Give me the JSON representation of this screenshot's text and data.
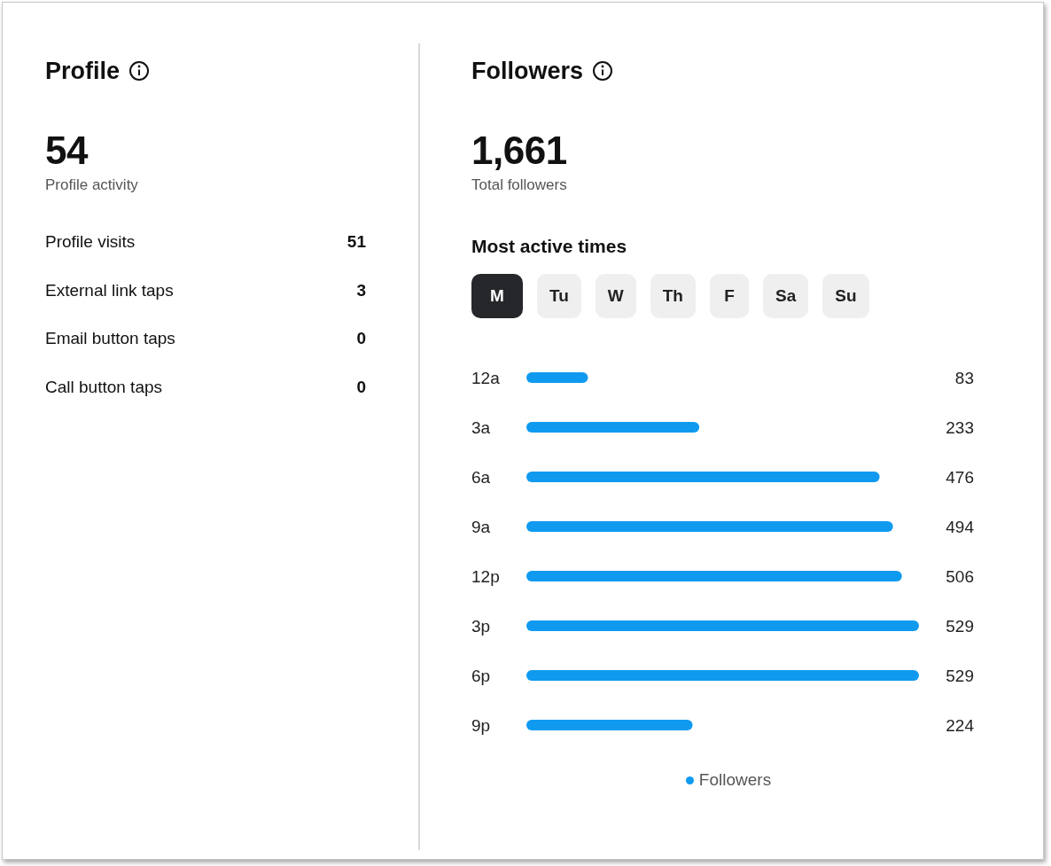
{
  "profile": {
    "title": "Profile",
    "total": "54",
    "total_label": "Profile activity",
    "metrics": [
      {
        "label": "Profile visits",
        "value": "51"
      },
      {
        "label": "External link taps",
        "value": "3"
      },
      {
        "label": "Email button taps",
        "value": "0"
      },
      {
        "label": "Call button taps",
        "value": "0"
      }
    ]
  },
  "followers": {
    "title": "Followers",
    "total": "1,661",
    "total_label": "Total followers",
    "section_title": "Most active times",
    "days": [
      {
        "label": "M",
        "selected": true
      },
      {
        "label": "Tu",
        "selected": false
      },
      {
        "label": "W",
        "selected": false
      },
      {
        "label": "Th",
        "selected": false
      },
      {
        "label": "F",
        "selected": false
      },
      {
        "label": "Sa",
        "selected": false
      },
      {
        "label": "Su",
        "selected": false
      }
    ],
    "chart_data": {
      "type": "bar",
      "orientation": "horizontal",
      "categories": [
        "12a",
        "3a",
        "6a",
        "9a",
        "12p",
        "3p",
        "6p",
        "9p"
      ],
      "series": [
        {
          "name": "Followers",
          "color": "#0f9af0",
          "values": [
            83,
            233,
            476,
            494,
            506,
            529,
            529,
            224
          ]
        }
      ],
      "data_labels": true
    }
  }
}
